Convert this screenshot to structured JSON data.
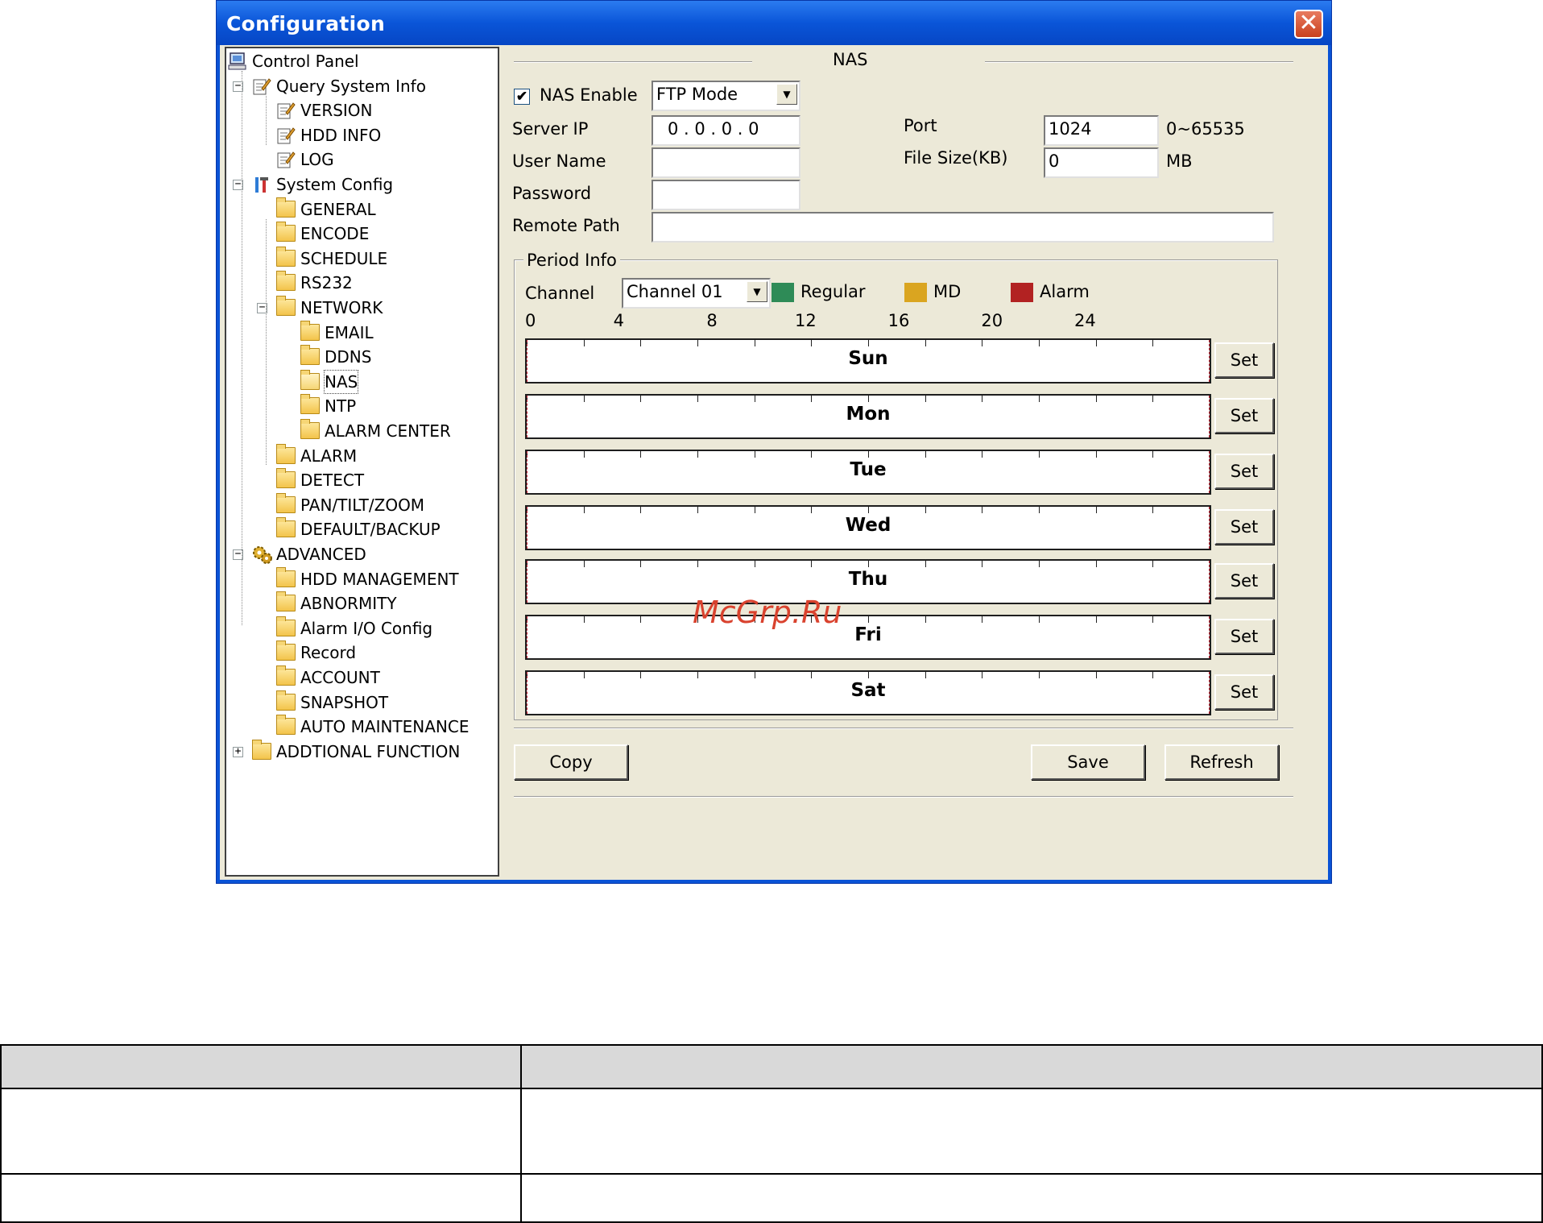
{
  "window": {
    "title": "Configuration",
    "close_glyph": "✕"
  },
  "tree": {
    "nodes": [
      {
        "label": "Control Panel",
        "icon": "computer-icon"
      },
      {
        "label": "Query System Info",
        "icon": "notepad-icon"
      },
      {
        "label": "VERSION",
        "icon": "notepad-icon"
      },
      {
        "label": "HDD INFO",
        "icon": "notepad-icon"
      },
      {
        "label": "LOG",
        "icon": "notepad-icon"
      },
      {
        "label": "System Config",
        "icon": "tools-icon"
      },
      {
        "label": "GENERAL",
        "icon": "folder-icon"
      },
      {
        "label": "ENCODE",
        "icon": "folder-icon"
      },
      {
        "label": "SCHEDULE",
        "icon": "folder-icon"
      },
      {
        "label": "RS232",
        "icon": "folder-icon"
      },
      {
        "label": "NETWORK",
        "icon": "folder-icon"
      },
      {
        "label": "EMAIL",
        "icon": "folder-icon"
      },
      {
        "label": "DDNS",
        "icon": "folder-icon"
      },
      {
        "label": "NAS",
        "icon": "folder-open-icon"
      },
      {
        "label": "NTP",
        "icon": "folder-icon"
      },
      {
        "label": "ALARM CENTER",
        "icon": "folder-icon"
      },
      {
        "label": "ALARM",
        "icon": "folder-icon"
      },
      {
        "label": "DETECT",
        "icon": "folder-icon"
      },
      {
        "label": "PAN/TILT/ZOOM",
        "icon": "folder-icon"
      },
      {
        "label": "DEFAULT/BACKUP",
        "icon": "folder-icon"
      },
      {
        "label": "ADVANCED",
        "icon": "gears-icon"
      },
      {
        "label": "HDD MANAGEMENT",
        "icon": "folder-icon"
      },
      {
        "label": "ABNORMITY",
        "icon": "folder-icon"
      },
      {
        "label": "Alarm I/O Config",
        "icon": "folder-icon"
      },
      {
        "label": "Record",
        "icon": "folder-icon"
      },
      {
        "label": "ACCOUNT",
        "icon": "folder-icon"
      },
      {
        "label": "SNAPSHOT",
        "icon": "folder-icon"
      },
      {
        "label": "AUTO MAINTENANCE",
        "icon": "folder-icon"
      },
      {
        "label": "ADDTIONAL FUNCTION",
        "icon": "folder-icon"
      }
    ],
    "expander_minus": "−",
    "expander_plus": "+"
  },
  "nas": {
    "section_title": "NAS",
    "enable_label": "NAS Enable",
    "enable_checked": true,
    "mode_value": "FTP Mode",
    "server_ip_label": "Server IP",
    "server_ip_value": "0 . 0 . 0 . 0",
    "user_name_label": "User Name",
    "user_name_value": "",
    "password_label": "Password",
    "password_value": "",
    "remote_path_label": "Remote Path",
    "remote_path_value": "",
    "port_label": "Port",
    "port_value": "1024",
    "port_range": "0~65535",
    "file_size_label": "File Size(KB)",
    "file_size_value": "0",
    "file_size_unit": "MB"
  },
  "period": {
    "group_title": "Period Info",
    "channel_label": "Channel",
    "channel_value": "Channel 01",
    "legend": [
      {
        "label": "Regular",
        "color": "#2e8b57"
      },
      {
        "label": "MD",
        "color": "#daa520"
      },
      {
        "label": "Alarm",
        "color": "#b22222"
      }
    ],
    "hours": [
      "0",
      "4",
      "8",
      "12",
      "16",
      "20",
      "24"
    ],
    "days": [
      "Sun",
      "Mon",
      "Tue",
      "Wed",
      "Thu",
      "Fri",
      "Sat"
    ],
    "set_label": "Set"
  },
  "buttons": {
    "copy": "Copy",
    "save": "Save",
    "refresh": "Refresh"
  },
  "watermark": "McGrp.Ru"
}
